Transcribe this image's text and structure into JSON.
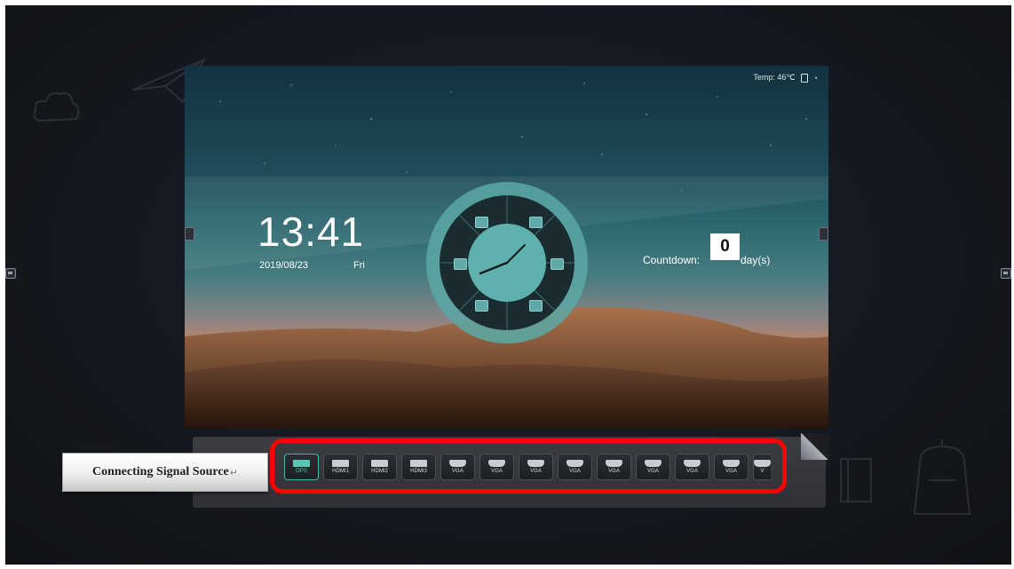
{
  "screen": {
    "status": {
      "temp_text": "Temp: 46℃"
    },
    "clock": {
      "time": "13:41",
      "date": "2019/08/23",
      "day": "Fri"
    },
    "countdown": {
      "label": "Countdown:",
      "value": "0",
      "unit": "day(s)"
    },
    "dial_icons": [
      "whiteboard-icon",
      "browser-icon",
      "apps-icon",
      "file-icon",
      "settings-icon",
      "tools-icon",
      "media-icon"
    ]
  },
  "callout": {
    "text": "Connecting Signal Source",
    "return_mark": "↵"
  },
  "sources": [
    {
      "label": "OPS",
      "icon": "ops-port-icon",
      "active": true
    },
    {
      "label": "HDMI1",
      "icon": "hdmi-port-icon"
    },
    {
      "label": "HDMI2",
      "icon": "hdmi-port-icon"
    },
    {
      "label": "HDMI3",
      "icon": "hdmi-port-icon"
    },
    {
      "label": "VGA",
      "icon": "vga-port-icon"
    },
    {
      "label": "VGA",
      "icon": "vga-port-icon"
    },
    {
      "label": "VGA",
      "icon": "vga-port-icon"
    },
    {
      "label": "VGA",
      "icon": "vga-port-icon"
    },
    {
      "label": "VGA",
      "icon": "vga-port-icon"
    },
    {
      "label": "VGA",
      "icon": "vga-port-icon"
    },
    {
      "label": "VGA",
      "icon": "vga-port-icon"
    },
    {
      "label": "VGA",
      "icon": "vga-port-icon"
    },
    {
      "label": "V",
      "icon": "vga-port-icon"
    }
  ],
  "colors": {
    "highlight": "#ff0000",
    "accent": "#58c8b6"
  }
}
